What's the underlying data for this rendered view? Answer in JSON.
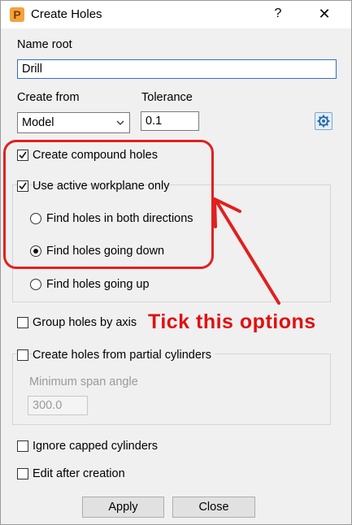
{
  "window": {
    "title": "Create Holes",
    "help": "?",
    "close": "✕",
    "app_icon": "P"
  },
  "name_root": {
    "label": "Name root",
    "value": "Drill"
  },
  "create_from": {
    "label": "Create from",
    "selected": "Model"
  },
  "tolerance": {
    "label": "Tolerance",
    "value": "0.1"
  },
  "options": {
    "create_compound_holes": {
      "label": "Create compound holes",
      "checked": true
    },
    "use_active_workplane_only": {
      "label": "Use active workplane only",
      "checked": true
    },
    "find_both_directions": {
      "label": "Find holes in both directions",
      "selected": false
    },
    "find_going_down": {
      "label": "Find holes going down",
      "selected": true
    },
    "find_going_up": {
      "label": "Find holes going up",
      "selected": false
    },
    "group_holes_by_axis": {
      "label": "Group holes by axis",
      "checked": false
    },
    "create_from_partial_cylinders": {
      "label": "Create holes from partial cylinders",
      "checked": false
    },
    "minimum_span_angle": {
      "label": "Minimum span angle",
      "value": "300.0"
    },
    "ignore_capped_cylinders": {
      "label": "Ignore capped cylinders",
      "checked": false
    },
    "edit_after_creation": {
      "label": "Edit after creation",
      "checked": false
    }
  },
  "buttons": {
    "apply": "Apply",
    "close": "Close"
  },
  "annotation": {
    "text": "Tick this options",
    "color": "#e01010"
  },
  "icons": {
    "settings": "gear-icon",
    "dropdown": "chevron-down-icon"
  }
}
